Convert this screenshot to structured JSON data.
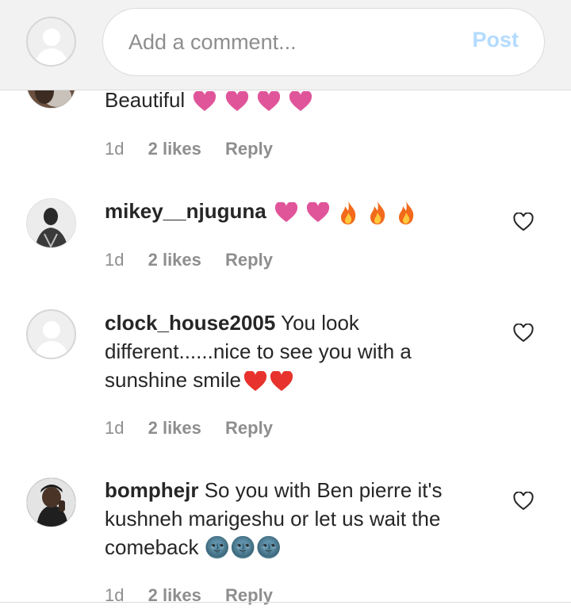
{
  "composer": {
    "placeholder": "Add a comment...",
    "post_label": "Post"
  },
  "comments": [
    {
      "username": "",
      "text": "Beautiful",
      "emojis": [
        "pink-heart",
        "pink-heart",
        "pink-heart",
        "pink-heart"
      ],
      "age": "1d",
      "likes": "2 likes",
      "reply": "Reply"
    },
    {
      "username": "mikey__njuguna",
      "text": "",
      "emojis": [
        "pink-heart",
        "pink-heart",
        "fire",
        "fire",
        "fire"
      ],
      "age": "1d",
      "likes": "2 likes",
      "reply": "Reply"
    },
    {
      "username": "clock_house2005",
      "text": "You look different......nice to see you with a sunshine smile",
      "emojis": [
        "red-heart",
        "red-heart"
      ],
      "age": "1d",
      "likes": "2 likes",
      "reply": "Reply"
    },
    {
      "username": "bomphejr",
      "text": "So you with Ben pierre it's kushneh marigeshu or let us wait the comeback 🌚🌚🌚",
      "emojis": [],
      "age": "1d",
      "likes": "2 likes",
      "reply": "Reply"
    }
  ],
  "colors": {
    "pink_heart": "#e0559a",
    "red_heart": "#e8322d",
    "post_disabled": "#b3dbff",
    "meta_gray": "#8e8e8e"
  },
  "icons": {
    "like": "heart-outline-icon",
    "default_avatar": "default-avatar-icon"
  }
}
